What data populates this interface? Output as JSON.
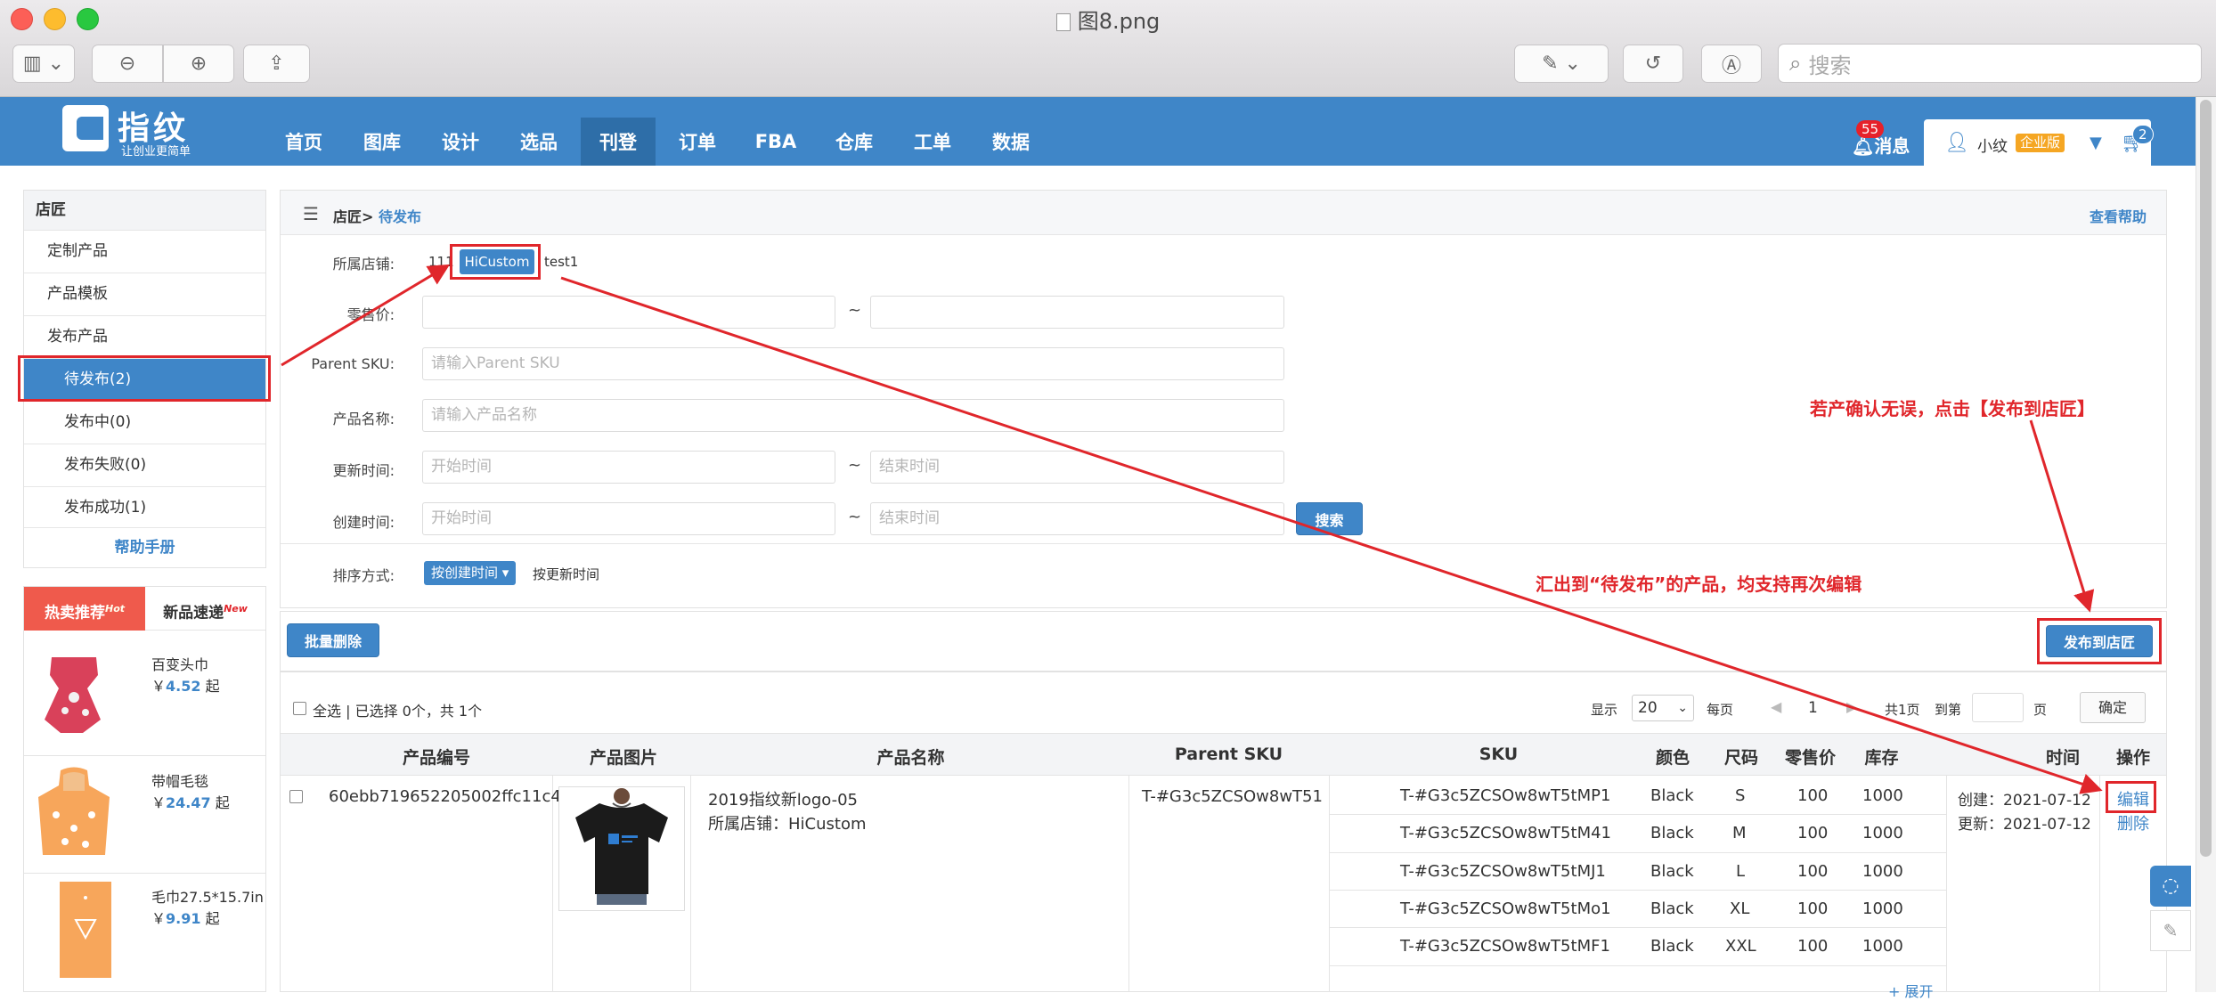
{
  "window": {
    "title": "图8.png",
    "search_placeholder": "搜索"
  },
  "header": {
    "logo_text": "指纹",
    "logo_sub": "让创业更简单",
    "nav": [
      "首页",
      "图库",
      "设计",
      "选品",
      "刊登",
      "订单",
      "FBA",
      "仓库",
      "工单",
      "数据"
    ],
    "active_nav": "刊登",
    "messages_label": "消息",
    "messages_count": "55",
    "user_name": "小纹",
    "user_level": "企业版",
    "cart_count": "2"
  },
  "sidebar": {
    "title": "店匠",
    "items": [
      "定制产品",
      "产品模板",
      "发布产品",
      "待发布(2)",
      "发布中(0)",
      "发布失败(0)",
      "发布成功(1)"
    ],
    "selected": "待发布(2)",
    "help": "帮助手册"
  },
  "promo": {
    "tabs": [
      "热卖推荐",
      "新品速递"
    ],
    "tab_tags": [
      "Hot",
      "New"
    ],
    "products": [
      {
        "name": "百变头巾",
        "price": "4.52",
        "currency": "￥",
        "suffix": "起"
      },
      {
        "name": "带帽毛毯",
        "price": "24.47",
        "currency": "￥",
        "suffix": "起"
      },
      {
        "name": "毛巾27.5*15.7in",
        "price": "9.91",
        "currency": "￥",
        "suffix": "起"
      }
    ]
  },
  "breadcrumb": {
    "root": "店匠>",
    "current": "待发布",
    "help": "查看帮助"
  },
  "filters": {
    "store_label": "所属店铺:",
    "stores": [
      "111",
      "HiCustom",
      "test1"
    ],
    "selected_store": "HiCustom",
    "price_label": "零售价:",
    "tilde": "~",
    "sku_label": "Parent SKU:",
    "sku_placeholder": "请输入Parent SKU",
    "name_label": "产品名称:",
    "name_placeholder": "请输入产品名称",
    "update_label": "更新时间:",
    "create_label": "创建时间:",
    "start_placeholder": "开始时间",
    "end_placeholder": "结束时间",
    "search_button": "搜索",
    "sort_label": "排序方式:",
    "sort_options": [
      "按创建时间 ▾",
      "按更新时间"
    ]
  },
  "actions": {
    "batch_delete": "批量删除",
    "publish": "发布到店匠"
  },
  "pager": {
    "select_all": "全选 | 已选择 0个，共 1个",
    "show": "显示",
    "page_size": "20",
    "per_page": "每页",
    "page": "1",
    "total_pages": "共1页",
    "goto": "到第",
    "page_unit": "页",
    "confirm": "确定"
  },
  "table": {
    "headers": [
      "产品编号",
      "产品图片",
      "产品名称",
      "Parent SKU",
      "SKU",
      "颜色",
      "尺码",
      "零售价",
      "库存",
      "时间",
      "操作"
    ],
    "row": {
      "id": "60ebb719652205002ffc11c4",
      "name": "2019指纹新logo-05",
      "store": "所属店铺：HiCustom",
      "parent_sku": "T-#G3c5ZCSOw8wT51",
      "created": "创建：2021-07-12",
      "updated": "更新：2021-07-12",
      "edit": "编辑",
      "delete": "删除",
      "expand": "+ 展开"
    },
    "variants": [
      {
        "sku": "T-#G3c5ZCSOw8wT5tMP1",
        "color": "Black",
        "size": "S",
        "price": "100",
        "stock": "1000"
      },
      {
        "sku": "T-#G3c5ZCSOw8wT5tM41",
        "color": "Black",
        "size": "M",
        "price": "100",
        "stock": "1000"
      },
      {
        "sku": "T-#G3c5ZCSOw8wT5tMJ1",
        "color": "Black",
        "size": "L",
        "price": "100",
        "stock": "1000"
      },
      {
        "sku": "T-#G3c5ZCSOw8wT5tMo1",
        "color": "Black",
        "size": "XL",
        "price": "100",
        "stock": "1000"
      },
      {
        "sku": "T-#G3c5ZCSOw8wT5tMF1",
        "color": "Black",
        "size": "XXL",
        "price": "100",
        "stock": "1000"
      }
    ]
  },
  "annotations": {
    "note1": "若产确认无误，点击【发布到店匠】",
    "note2": "汇出到“待发布”的产品，均支持再次编辑"
  },
  "colors": {
    "brand": "#3f86c8",
    "annotation": "#e0262b"
  }
}
